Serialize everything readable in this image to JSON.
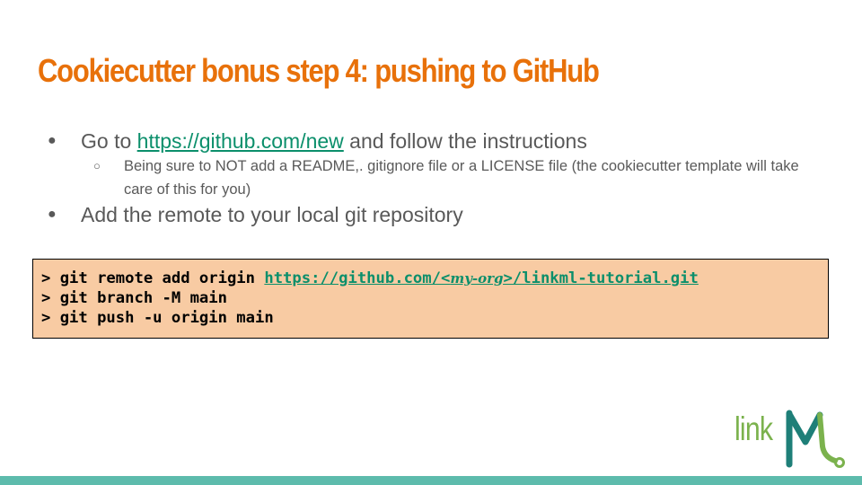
{
  "slide": {
    "title": "Cookiecutter bonus step 4: pushing to GitHub",
    "colors": {
      "title": "#e8710a",
      "body_text": "#595959",
      "link": "#0b8f6b",
      "code_bg": "#f8cba3",
      "accent_bar": "#5dbbac",
      "logo_green": "#7bb24d",
      "logo_teal": "#1e7f78"
    }
  },
  "bullets": {
    "item1": {
      "prefix": "Go to ",
      "link_text": "https://github.com/new",
      "suffix": " and follow the instructions"
    },
    "item1_sub": "Being sure to NOT add a README,. gitignore file or a LICENSE file (the cookiecutter template will take care of this for you)",
    "item2": "Add the remote to your local git repository"
  },
  "code": {
    "line1_prefix": "> git remote add origin ",
    "line1_url_start": "https://github.com/<",
    "line1_url_placeholder": "my-org",
    "line1_url_end": ">/linkml-tutorial.git",
    "line2": "> git branch -M main",
    "line3": "> git push -u origin main"
  },
  "logo": {
    "text": "link",
    "icon": "linkml-m-icon"
  }
}
